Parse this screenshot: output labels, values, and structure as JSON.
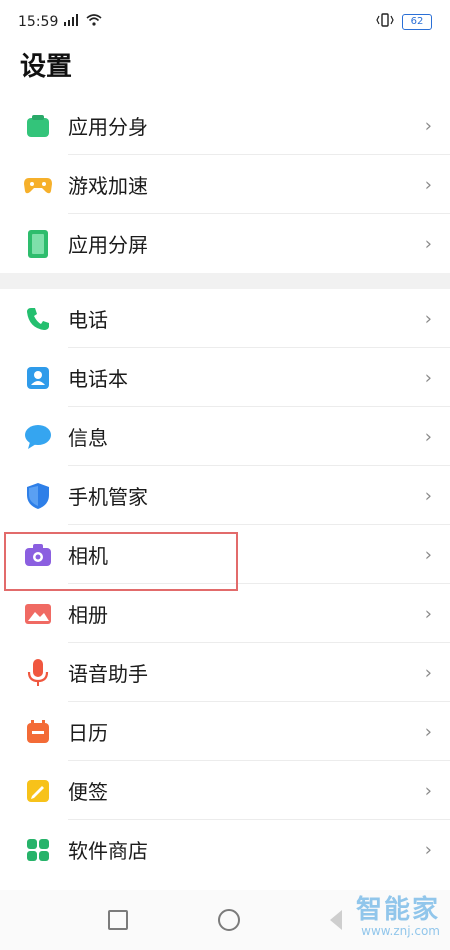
{
  "status": {
    "time": "15:59",
    "battery": "62"
  },
  "page": {
    "title": "设置"
  },
  "section1": [
    {
      "label": "应用分身",
      "icon": "app-clone-icon"
    },
    {
      "label": "游戏加速",
      "icon": "game-controller-icon"
    },
    {
      "label": "应用分屏",
      "icon": "split-screen-icon"
    }
  ],
  "section2": [
    {
      "label": "电话",
      "icon": "phone-icon"
    },
    {
      "label": "电话本",
      "icon": "contacts-icon"
    },
    {
      "label": "信息",
      "icon": "message-icon"
    },
    {
      "label": "手机管家",
      "icon": "shield-icon"
    },
    {
      "label": "相机",
      "icon": "camera-icon"
    },
    {
      "label": "相册",
      "icon": "gallery-icon"
    },
    {
      "label": "语音助手",
      "icon": "voice-assistant-icon"
    },
    {
      "label": "日历",
      "icon": "calendar-icon"
    },
    {
      "label": "便签",
      "icon": "notes-icon"
    },
    {
      "label": "软件商店",
      "icon": "app-store-icon"
    }
  ],
  "watermark": {
    "title": "智能家",
    "url": "www.znj.com"
  }
}
